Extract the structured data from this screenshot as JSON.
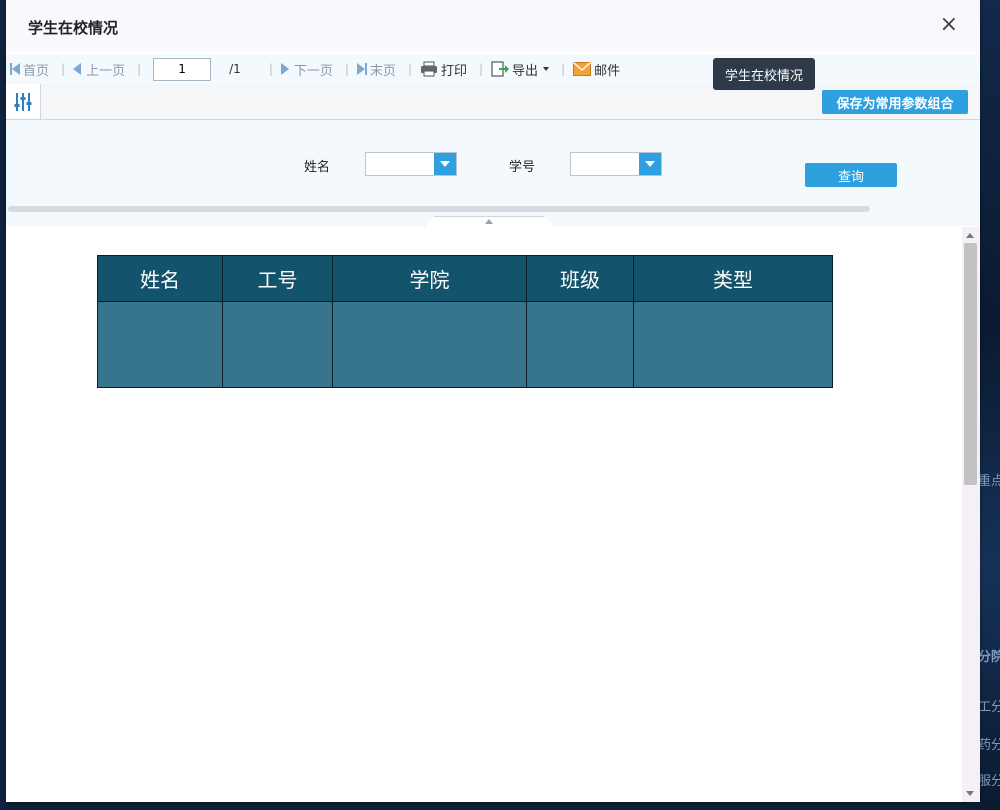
{
  "dialog": {
    "title": "学生在校情况",
    "close_symbol": "×"
  },
  "toolbar": {
    "first_label": "首页",
    "prev_label": "上一页",
    "page_value": "1",
    "page_total": "/1",
    "next_label": "下一页",
    "last_label": "末页",
    "print_label": "打印",
    "export_label": "导出",
    "mail_label": "邮件"
  },
  "tooltip": {
    "text": "学生在校情况"
  },
  "params_bar": {
    "save_label": "保存为常用参数组合",
    "name_label": "姓名",
    "id_label": "学号",
    "query_label": "查询"
  },
  "table": {
    "headers": [
      "姓名",
      "工号",
      "学院",
      "班级",
      "类型"
    ]
  },
  "background_fragments": [
    "重点",
    "分院",
    "工分",
    "药分",
    "服分"
  ],
  "colors": {
    "accent": "#2ea0e0",
    "header_bg": "#13536b",
    "cell_bg": "#37748e"
  }
}
